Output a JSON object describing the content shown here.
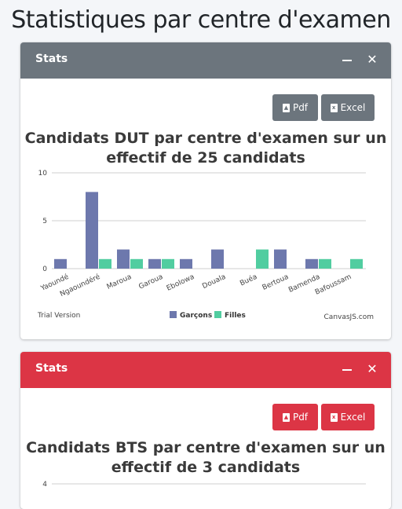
{
  "page": {
    "title": "Statistiques par centre d'examen"
  },
  "colors": {
    "header_gray": "#6c757d",
    "header_red": "#dc3545",
    "garcons": "#6d78ad",
    "filles": "#51cda0",
    "button_gray": "#6c757d",
    "button_red": "#dc3545"
  },
  "cards": [
    {
      "header": {
        "title": "Stats",
        "minimize_icon": "minus-icon",
        "close_icon": "close-icon"
      },
      "buttons": {
        "pdf": "Pdf",
        "excel": "Excel"
      },
      "chart": {
        "title_line1": "Candidats DUT par centre d'examen sur un",
        "title_line2": "effectif de 25 candidats",
        "footer_left": "Trial Version",
        "footer_right": "CanvasJS.com"
      }
    },
    {
      "header": {
        "title": "Stats",
        "minimize_icon": "minus-icon",
        "close_icon": "close-icon"
      },
      "buttons": {
        "pdf": "Pdf",
        "excel": "Excel"
      },
      "chart": {
        "title_line1": "Candidats BTS par centre d'examen sur un",
        "title_line2": "effectif de 3 candidats"
      }
    }
  ],
  "chart_data": [
    {
      "type": "bar",
      "title": "Candidats DUT par centre d'examen sur un effectif de 25 candidats",
      "categories": [
        "Yaoundé",
        "Ngaoundéré",
        "Maroua",
        "Garoua",
        "Ebolowa",
        "Douala",
        "Buéa",
        "Bertoua",
        "Bamenda",
        "Bafoussam"
      ],
      "series": [
        {
          "name": "Garçons",
          "values": [
            1,
            8,
            2,
            1,
            1,
            2,
            0,
            2,
            1,
            0
          ]
        },
        {
          "name": "Filles",
          "values": [
            0,
            1,
            1,
            1,
            0,
            0,
            2,
            0,
            1,
            1
          ]
        }
      ],
      "ylim": [
        0,
        10
      ],
      "yticks": [
        0,
        5,
        10
      ],
      "grid": true,
      "legend": "bottom"
    },
    {
      "type": "bar",
      "title": "Candidats BTS par centre d'examen sur un effectif de 3 candidats",
      "yticks": [
        4
      ]
    }
  ]
}
